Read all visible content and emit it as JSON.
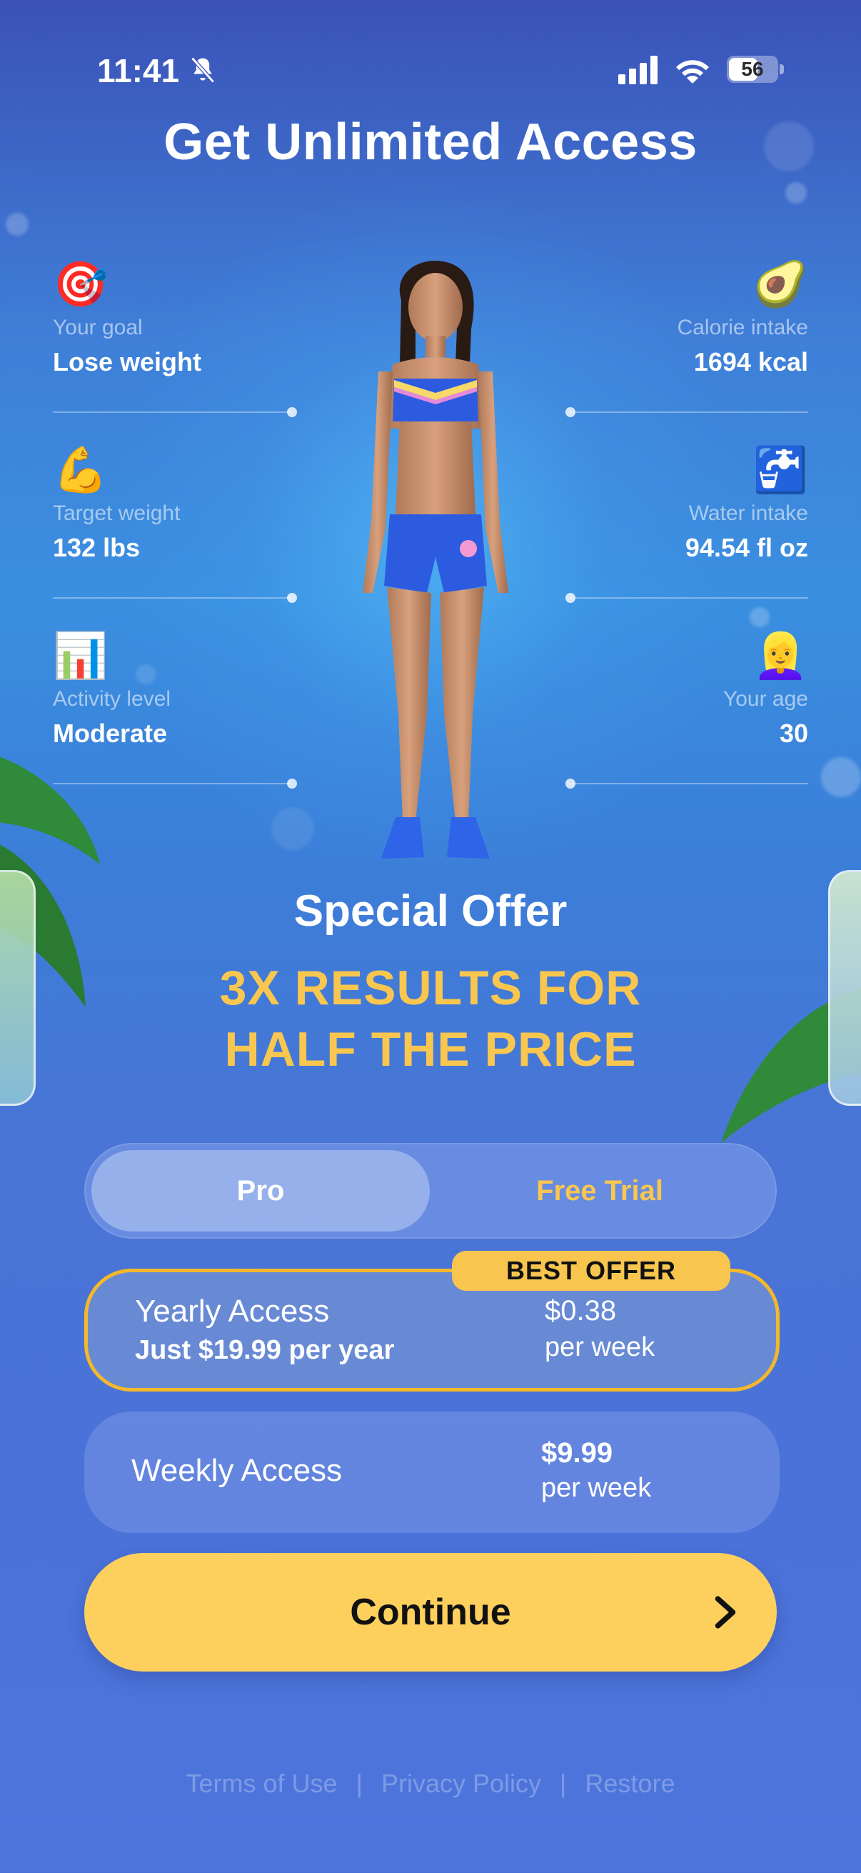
{
  "status_bar": {
    "time": "11:41",
    "battery": "56"
  },
  "title": "Get Unlimited Access",
  "stats": {
    "goal": {
      "icon": "🎯",
      "label": "Your goal",
      "value": "Lose weight"
    },
    "calorie": {
      "icon": "🥑",
      "label": "Calorie intake",
      "value": "1694 kcal"
    },
    "target_weight": {
      "icon": "💪",
      "label": "Target weight",
      "value": "132 lbs"
    },
    "water": {
      "icon": "🚰",
      "label": "Water intake",
      "value": "94.54 fl oz"
    },
    "activity": {
      "icon": "📊",
      "label": "Activity level",
      "value": "Moderate"
    },
    "age": {
      "icon": "👱‍♀️",
      "label": "Your age",
      "value": "30"
    }
  },
  "offer": {
    "special": "Special Offer",
    "headline_line1": "3X RESULTS FOR",
    "headline_line2": "HALF THE PRICE"
  },
  "tabs": {
    "pro": "Pro",
    "free_trial": "Free Trial",
    "selected": "Pro"
  },
  "plans": {
    "yearly": {
      "badge": "BEST OFFER",
      "name": "Yearly Access",
      "sub": "Just $19.99 per year",
      "price": "$0.38",
      "per": "per week"
    },
    "weekly": {
      "name": "Weekly Access",
      "price": "$9.99",
      "per": "per week"
    }
  },
  "continue_label": "Continue",
  "footer": {
    "terms": "Terms of Use",
    "privacy": "Privacy Policy",
    "restore": "Restore",
    "separator": "|"
  },
  "colors": {
    "accent_yellow": "#f9c64f",
    "button": "#fdd05e",
    "selected_border": "#f5b82a"
  },
  "icons": {
    "bell": "bell-slash-icon",
    "signal": "cellular-signal-icon",
    "wifi": "wifi-icon",
    "battery": "battery-icon",
    "arrow": "chevron-right-icon"
  }
}
